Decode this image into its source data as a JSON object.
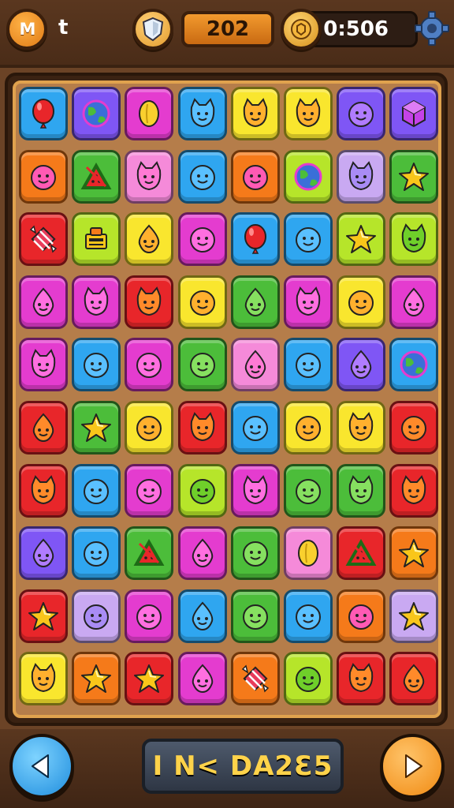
{
  "header": {
    "profile_mark": "M",
    "player_label": "t",
    "score": "202",
    "timer": "0:506"
  },
  "footer": {
    "center_label": "I N< DA2Ɛ5"
  },
  "colors": {
    "blue": "#2fa6f0",
    "purple": "#7f56f5",
    "magenta": "#e43ccf",
    "yellow": "#f9e62e",
    "green": "#4cbd3a",
    "lime": "#b6e52a",
    "orange": "#f57a1a",
    "red": "#e8262a",
    "pink": "#f58ad9",
    "lilac": "#c9a9f2"
  },
  "board": {
    "rows": [
      [
        {
          "bg": "blue",
          "icon": "balloon"
        },
        {
          "bg": "purple",
          "icon": "globe"
        },
        {
          "bg": "magenta",
          "icon": "lemon"
        },
        {
          "bg": "blue",
          "icon": "cat-face"
        },
        {
          "bg": "yellow",
          "icon": "cat-face"
        },
        {
          "bg": "yellow",
          "icon": "cat-face"
        },
        {
          "bg": "purple",
          "icon": "blob-face"
        },
        {
          "bg": "purple",
          "icon": "cube"
        }
      ],
      [
        {
          "bg": "orange",
          "icon": "blob-face"
        },
        {
          "bg": "green",
          "icon": "watermelon"
        },
        {
          "bg": "pink",
          "icon": "cat-face"
        },
        {
          "bg": "blue",
          "icon": "blob-face"
        },
        {
          "bg": "orange",
          "icon": "blob-face"
        },
        {
          "bg": "lime",
          "icon": "globe"
        },
        {
          "bg": "lilac",
          "icon": "cat-face"
        },
        {
          "bg": "green",
          "icon": "star"
        }
      ],
      [
        {
          "bg": "red",
          "icon": "wrapped-candy"
        },
        {
          "bg": "lime",
          "icon": "robot"
        },
        {
          "bg": "yellow",
          "icon": "drop-face"
        },
        {
          "bg": "magenta",
          "icon": "blob-face"
        },
        {
          "bg": "blue",
          "icon": "balloon"
        },
        {
          "bg": "blue",
          "icon": "blob-face"
        },
        {
          "bg": "lime",
          "icon": "star"
        },
        {
          "bg": "lime",
          "icon": "cat-face"
        }
      ],
      [
        {
          "bg": "magenta",
          "icon": "drop-face"
        },
        {
          "bg": "magenta",
          "icon": "cat-face"
        },
        {
          "bg": "red",
          "icon": "cat-face"
        },
        {
          "bg": "yellow",
          "icon": "blob-face"
        },
        {
          "bg": "green",
          "icon": "drop-face"
        },
        {
          "bg": "magenta",
          "icon": "cat-face"
        },
        {
          "bg": "yellow",
          "icon": "blob-face"
        },
        {
          "bg": "magenta",
          "icon": "drop-face"
        }
      ],
      [
        {
          "bg": "magenta",
          "icon": "cat-face"
        },
        {
          "bg": "blue",
          "icon": "blob-face"
        },
        {
          "bg": "magenta",
          "icon": "blob-face"
        },
        {
          "bg": "green",
          "icon": "blob-face"
        },
        {
          "bg": "pink",
          "icon": "drop-face"
        },
        {
          "bg": "blue",
          "icon": "blob-face"
        },
        {
          "bg": "purple",
          "icon": "drop-face"
        },
        {
          "bg": "blue",
          "icon": "globe"
        }
      ],
      [
        {
          "bg": "red",
          "icon": "drop-face"
        },
        {
          "bg": "green",
          "icon": "star"
        },
        {
          "bg": "yellow",
          "icon": "blob-face"
        },
        {
          "bg": "red",
          "icon": "cat-face"
        },
        {
          "bg": "blue",
          "icon": "blob-face"
        },
        {
          "bg": "yellow",
          "icon": "blob-face"
        },
        {
          "bg": "yellow",
          "icon": "cat-face"
        },
        {
          "bg": "red",
          "icon": "blob-face"
        }
      ],
      [
        {
          "bg": "red",
          "icon": "cat-face"
        },
        {
          "bg": "blue",
          "icon": "blob-face"
        },
        {
          "bg": "magenta",
          "icon": "blob-face"
        },
        {
          "bg": "lime",
          "icon": "blob-face"
        },
        {
          "bg": "magenta",
          "icon": "cat-face"
        },
        {
          "bg": "green",
          "icon": "blob-face"
        },
        {
          "bg": "green",
          "icon": "cat-face"
        },
        {
          "bg": "red",
          "icon": "cat-face"
        }
      ],
      [
        {
          "bg": "purple",
          "icon": "drop-face"
        },
        {
          "bg": "blue",
          "icon": "blob-face"
        },
        {
          "bg": "green",
          "icon": "watermelon"
        },
        {
          "bg": "magenta",
          "icon": "drop-face"
        },
        {
          "bg": "green",
          "icon": "blob-face"
        },
        {
          "bg": "pink",
          "icon": "lemon"
        },
        {
          "bg": "red",
          "icon": "watermelon"
        },
        {
          "bg": "orange",
          "icon": "star"
        }
      ],
      [
        {
          "bg": "red",
          "icon": "star"
        },
        {
          "bg": "lilac",
          "icon": "blob-face"
        },
        {
          "bg": "magenta",
          "icon": "blob-face"
        },
        {
          "bg": "blue",
          "icon": "drop-face"
        },
        {
          "bg": "green",
          "icon": "blob-face"
        },
        {
          "bg": "blue",
          "icon": "blob-face"
        },
        {
          "bg": "orange",
          "icon": "blob-face"
        },
        {
          "bg": "lilac",
          "icon": "star"
        }
      ],
      [
        {
          "bg": "yellow",
          "icon": "cat-face"
        },
        {
          "bg": "orange",
          "icon": "star"
        },
        {
          "bg": "red",
          "icon": "star"
        },
        {
          "bg": "magenta",
          "icon": "drop-face"
        },
        {
          "bg": "orange",
          "icon": "wrapped-candy"
        },
        {
          "bg": "lime",
          "icon": "blob-face"
        },
        {
          "bg": "red",
          "icon": "cat-face"
        },
        {
          "bg": "red",
          "icon": "drop-face"
        }
      ]
    ]
  }
}
